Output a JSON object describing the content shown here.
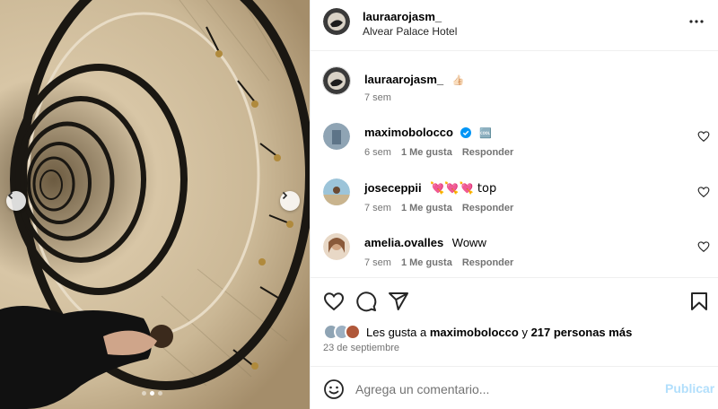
{
  "post": {
    "username": "lauraarojasm_",
    "location": "Alvear Palace Hotel",
    "caption_emoji": "👍🏻",
    "caption_time": "7 sem"
  },
  "comments": [
    {
      "username": "maximobolocco",
      "text": "🆒",
      "verified": true,
      "time": "6 sem",
      "likes": "1 Me gusta",
      "reply": "Responder"
    },
    {
      "username": "joseceppii",
      "text": "💘💘💘 top",
      "verified": false,
      "time": "7 sem",
      "likes": "1 Me gusta",
      "reply": "Responder"
    },
    {
      "username": "amelia.ovalles",
      "text": "Woww",
      "verified": false,
      "time": "7 sem",
      "likes": "1 Me gusta",
      "reply": "Responder"
    }
  ],
  "likes": {
    "prefix": "Les gusta a",
    "user": "maximobolocco",
    "connector": "y",
    "others": "217 personas más"
  },
  "date": "23 de septiembre",
  "comment_box": {
    "placeholder": "Agrega un comentario...",
    "publish_label": "Publicar"
  },
  "carousel": {
    "total": 3,
    "current": 2
  },
  "icons": {
    "more": "more-horizontal-icon",
    "like": "heart-icon",
    "comment": "comment-icon",
    "share": "share-icon",
    "save": "bookmark-icon",
    "emoji": "smiley-icon",
    "prev": "chevron-left-icon",
    "next": "chevron-right-icon",
    "verified": "verified-badge-icon"
  },
  "colors": {
    "link": "#0095f6",
    "publish_disabled": "#b2dffc",
    "meta": "#737373",
    "verified": "#0095f6"
  }
}
